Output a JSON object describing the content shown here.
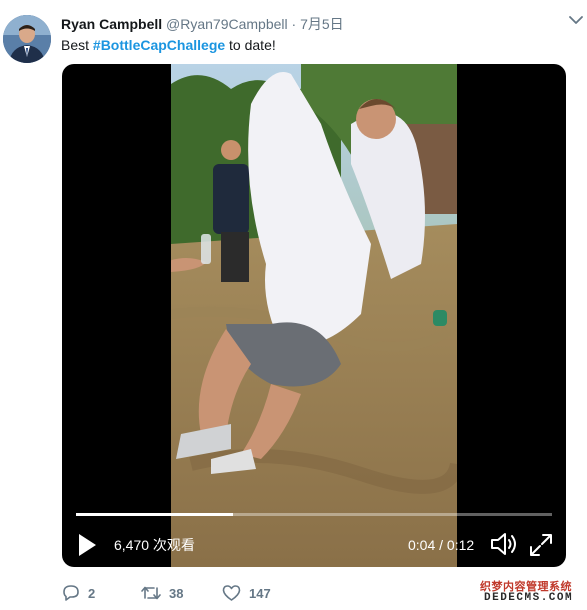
{
  "tweet": {
    "author_name": "Ryan Campbell",
    "handle": "@Ryan79Campbell",
    "separator": "·",
    "date": "7月5日",
    "text_prefix": "Best ",
    "hashtag": "#BottleCapChallege",
    "text_suffix": " to date!"
  },
  "video": {
    "views": "6,470 次观看",
    "time": "0:04 / 0:12",
    "progress_fraction": 0.33
  },
  "actions": {
    "reply_count": "2",
    "retweet_count": "38",
    "like_count": "147"
  },
  "watermark": {
    "line1": "织梦内容管理系统",
    "line2": "DEDECMS.COM"
  },
  "colors": {
    "link": "#1b95e0",
    "muted": "#657786",
    "text": "#14171a"
  },
  "icons": [
    "caret-down-icon",
    "play-icon",
    "volume-icon",
    "fullscreen-icon",
    "reply-icon",
    "retweet-icon",
    "like-icon"
  ]
}
